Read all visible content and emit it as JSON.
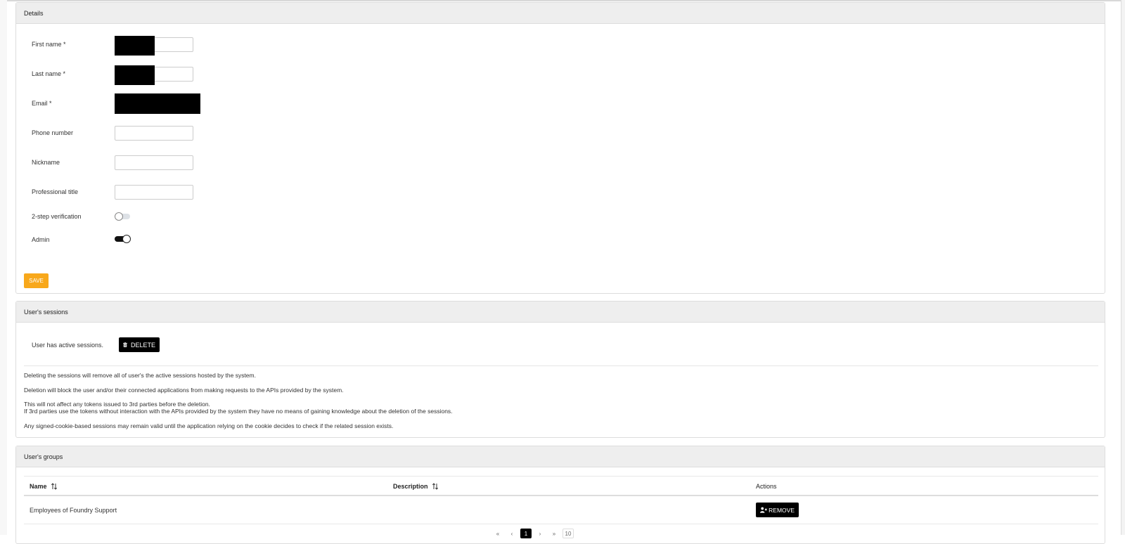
{
  "details": {
    "title": "Details",
    "fields": {
      "first_name": {
        "label": "First name *",
        "value": ""
      },
      "last_name": {
        "label": "Last name *",
        "value": ""
      },
      "email": {
        "label": "Email *",
        "value": ""
      },
      "phone": {
        "label": "Phone number",
        "value": ""
      },
      "nickname": {
        "label": "Nickname",
        "value": ""
      },
      "professional_title": {
        "label": "Professional title",
        "value": ""
      }
    },
    "two_step": {
      "label": "2-step verification",
      "state": "off"
    },
    "admin": {
      "label": "Admin",
      "state": "on"
    },
    "save_label": "SAVE"
  },
  "sessions": {
    "title": "User's sessions",
    "status_text": "User has active sessions.",
    "delete_label": "DELETE",
    "info": [
      "Deleting the sessions will remove all of user's the active sessions hosted by the system.",
      "Deletion will block the user and/or their connected applications from making requests to the APIs provided by the system.",
      "This will not affect any tokens issued to 3rd parties before the deletion.",
      "If 3rd parties use the tokens without interaction with the APIs provided by the system they have no means of gaining knowledge about the deletion of the sessions.",
      "Any signed-cookie-based sessions may remain valid until the application relying on the cookie decides to check if the related session exists."
    ]
  },
  "groups": {
    "title": "User's groups",
    "columns": {
      "name": "Name",
      "description": "Description",
      "actions": "Actions"
    },
    "rows": [
      {
        "name": "Employees of Foundry Support",
        "description": "",
        "action_label": "REMOVE"
      }
    ],
    "pagination": {
      "first": "«",
      "prev": "‹",
      "current": "1",
      "next": "›",
      "last": "»",
      "page_size": "10"
    }
  },
  "icons": {
    "sort": "sort-updown-icon",
    "trash": "trash-icon",
    "user_remove": "user-remove-icon"
  }
}
